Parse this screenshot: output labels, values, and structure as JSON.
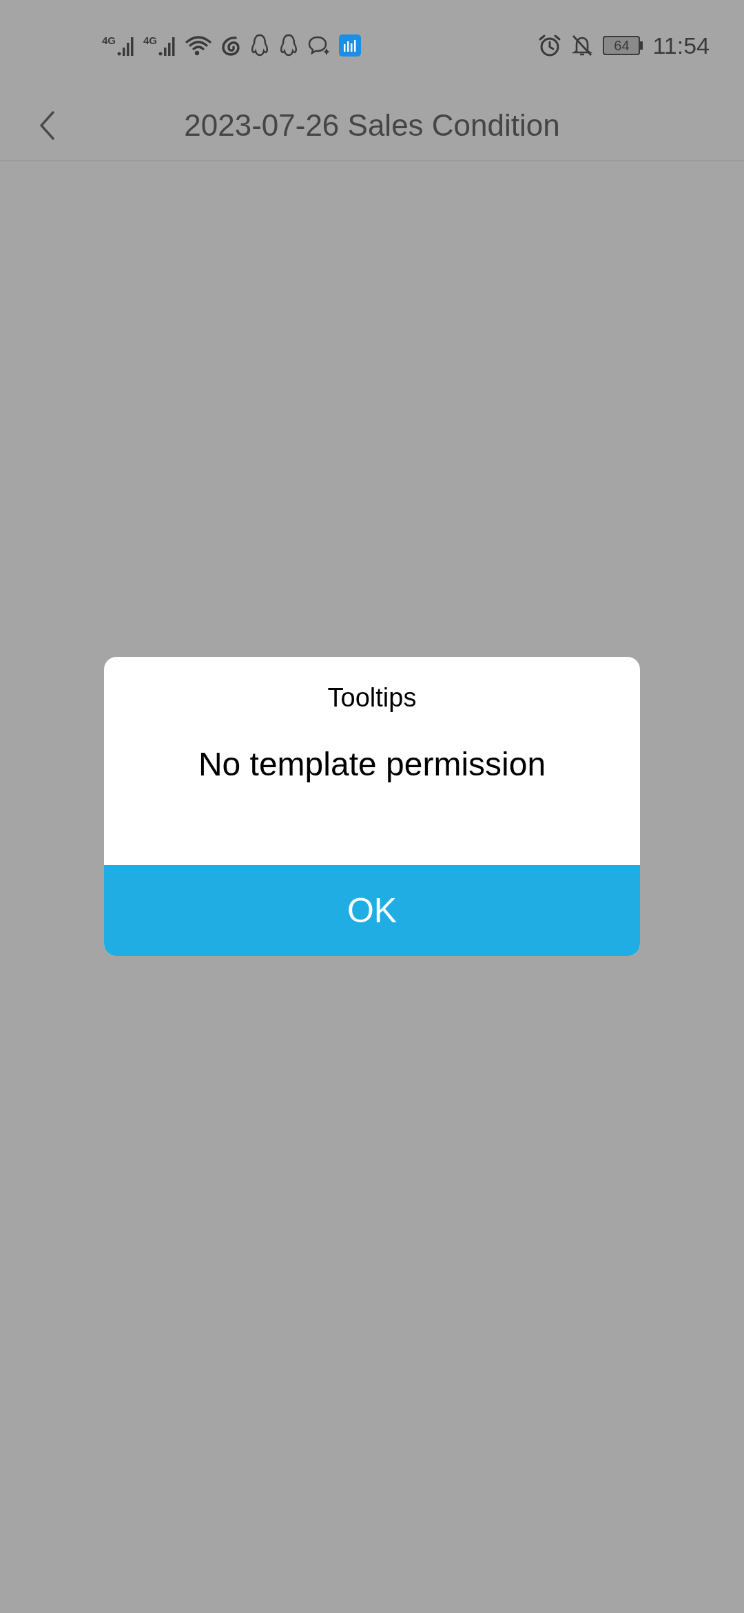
{
  "status_bar": {
    "networks": [
      "4G",
      "4G"
    ],
    "battery": "64",
    "time": "11:54"
  },
  "header": {
    "title": "2023-07-26 Sales Condition"
  },
  "dialog": {
    "title": "Tooltips",
    "message": "No template permission",
    "buttons": [
      "OK"
    ]
  }
}
